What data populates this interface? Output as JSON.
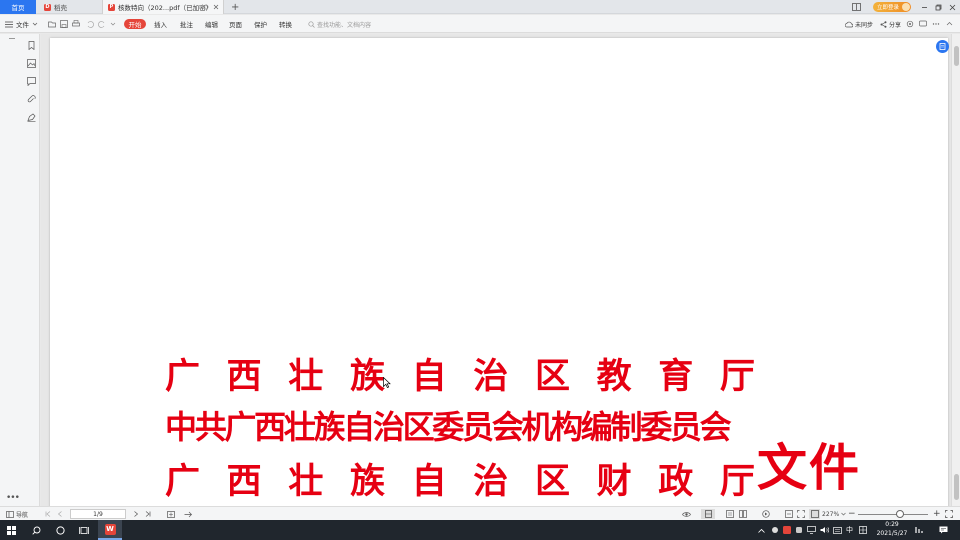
{
  "tabs": {
    "home": "首页",
    "shell": "稻壳",
    "doc": "核数特向（202...pdf（已加密）",
    "add": "+"
  },
  "login": "立即登录",
  "ribbon": {
    "file": "文件",
    "tabs": [
      "开始",
      "插入",
      "批注",
      "编辑",
      "页面",
      "保护",
      "转换"
    ],
    "active_tab": "开始",
    "search_placeholder": "查找功能、文档内容",
    "sync": "未同步",
    "share": "分享"
  },
  "document": {
    "org_line1": [
      "广",
      "西",
      "壮",
      "族",
      "自",
      "治",
      "区",
      "教",
      "育",
      "厅"
    ],
    "org_line2": "中共广西壮族自治区委员会机构编制委员会",
    "org_line3": [
      "广",
      "西",
      "壮",
      "族",
      "自",
      "治",
      "区",
      "财",
      "政",
      "厅"
    ],
    "doc_type": "文件",
    "heading_color": "#e60012"
  },
  "statusbar": {
    "nav": "导航",
    "page": "1/9",
    "zoom": "227%"
  },
  "taskbar": {
    "input_lang": "中",
    "time": "0:29",
    "date": "2021/5/27"
  },
  "colors": {
    "accent": "#2b76f0",
    "start_tab": "#e5453a"
  }
}
